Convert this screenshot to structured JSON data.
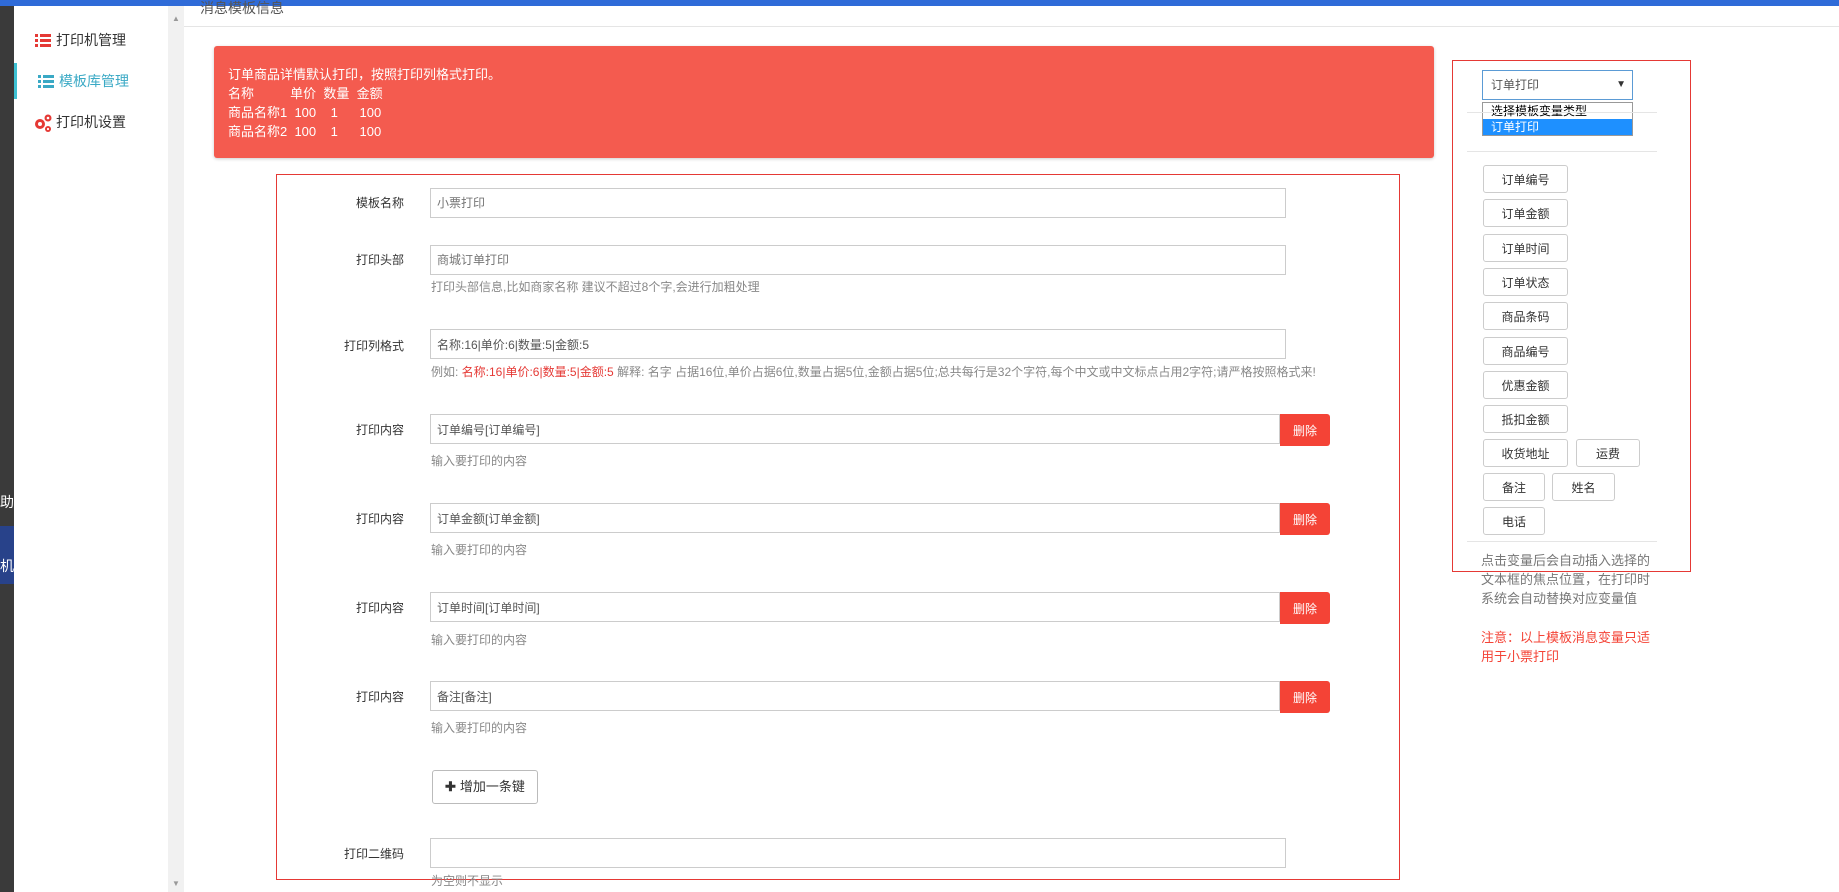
{
  "page_header": {
    "title": "消息模板信息"
  },
  "left_fragments": {
    "f1": "助",
    "f2": "机"
  },
  "sidebar": {
    "items": [
      {
        "label": "打印机管理",
        "icon": "list-icon"
      },
      {
        "label": "模板库管理",
        "icon": "list-icon"
      },
      {
        "label": "打印机设置",
        "icon": "gears-icon"
      }
    ]
  },
  "alert": {
    "lines": [
      "订单商品详情默认打印，按照打印列格式打印。",
      "名称          单价  数量  金额",
      "商品名称1  100    1      100",
      "商品名称2  100    1      100"
    ]
  },
  "form": {
    "template_name": {
      "label": "模板名称",
      "placeholder": "小票打印"
    },
    "print_header": {
      "label": "打印头部",
      "placeholder": "商城订单打印",
      "help": "打印头部信息,比如商家名称 建议不超过8个字,会进行加粗处理"
    },
    "column_format": {
      "label": "打印列格式",
      "value": "名称:16|单价:6|数量:5|金额:5",
      "help_prefix": "例如: ",
      "help_example": "名称:16|单价:6|数量:5|金额:5",
      "help_suffix": " 解释: 名字 占据16位,单价占据6位,数量占据5位,金额占据5位;总共每行是32个字符,每个中文或中文标点占用2字符;请严格按照格式来!"
    },
    "content_rows": [
      {
        "label": "打印内容",
        "value": "订单编号[订单编号]",
        "delete": "删除",
        "help": "输入要打印的内容"
      },
      {
        "label": "打印内容",
        "value": "订单金额[订单金额]",
        "delete": "删除",
        "help": "输入要打印的内容"
      },
      {
        "label": "打印内容",
        "value": "订单时间[订单时间]",
        "delete": "删除",
        "help": "输入要打印的内容"
      },
      {
        "label": "打印内容",
        "value": "备注[备注]",
        "delete": "删除",
        "help": "输入要打印的内容"
      }
    ],
    "add_button": "增加一条键",
    "qrcode": {
      "label": "打印二维码",
      "value": "",
      "help": "为空则不显示"
    }
  },
  "variables": {
    "select_value": "订单打印",
    "options": [
      "选择模板变量类型",
      "订单打印"
    ],
    "buttons": [
      "订单编号",
      "订单金额",
      "订单时间",
      "订单状态",
      "商品条码",
      "商品编号",
      "优惠金额",
      "抵扣金额",
      "收货地址",
      "运费",
      "备注",
      "姓名",
      "电话"
    ],
    "note": "点击变量后会自动插入选择的文本框的焦点位置，在打印时系统会自动替换对应变量值",
    "warning": "注意：以上模板消息变量只适用于小票打印"
  },
  "colors": {
    "accent_red": "#f44336",
    "alert_bg": "#f45b4f",
    "active_blue": "#3aa9c5"
  }
}
